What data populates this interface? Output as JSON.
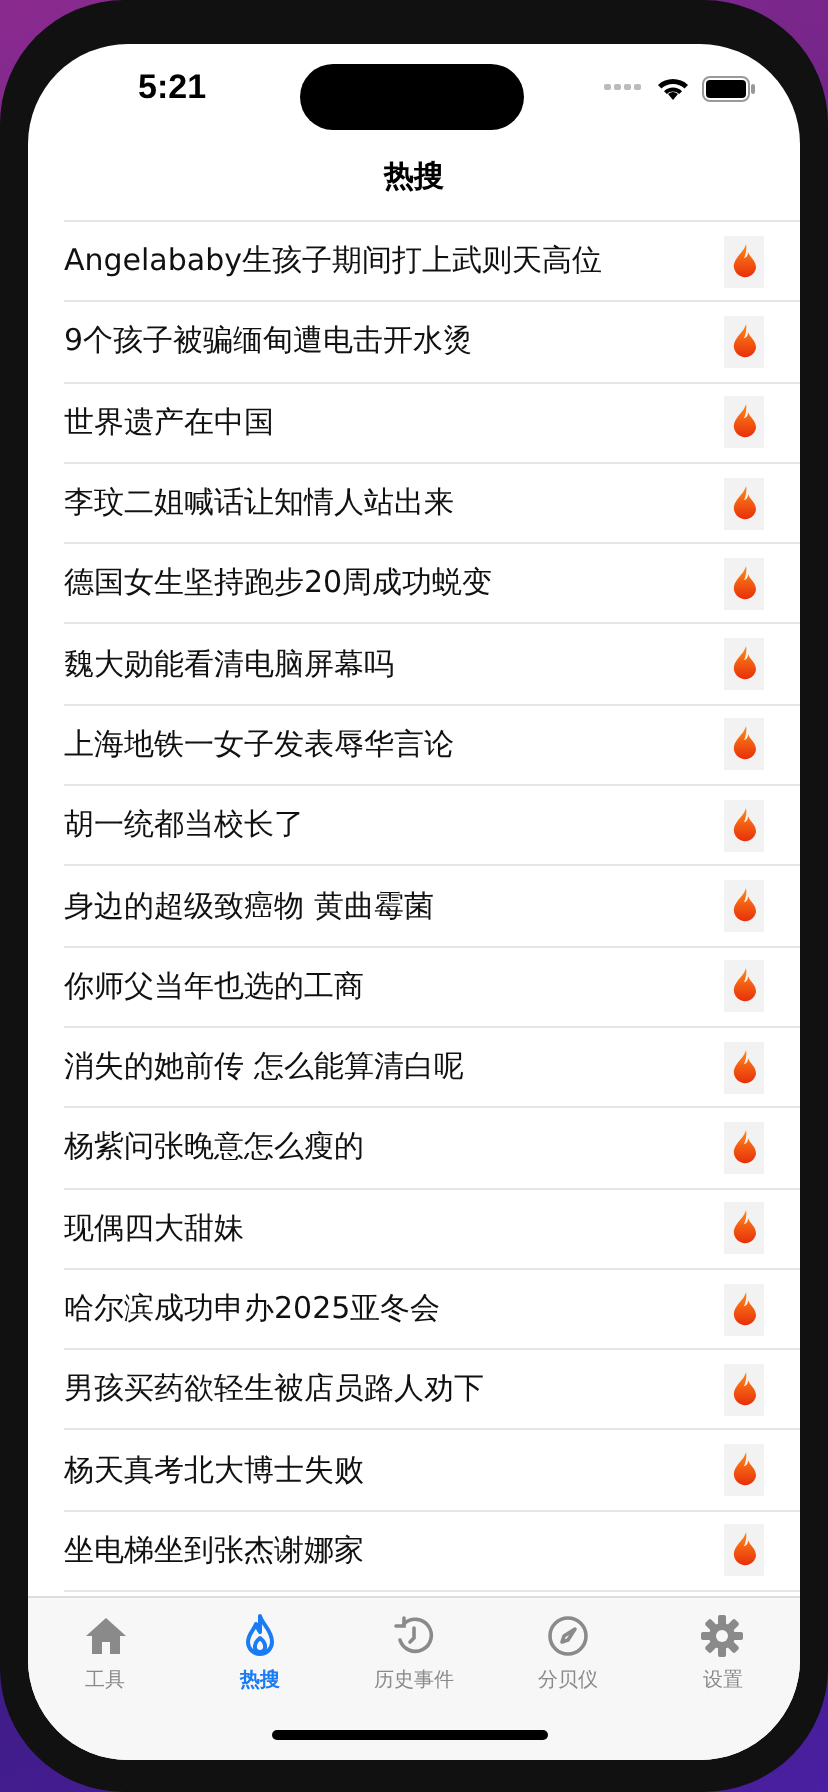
{
  "status_bar": {
    "time": "5:21"
  },
  "nav": {
    "title": "热搜"
  },
  "items": [
    {
      "title": "Angelababy生孩子期间打上武则天高位"
    },
    {
      "title": "9个孩子被骗缅甸遭电击开水烫"
    },
    {
      "title": "世界遗产在中国"
    },
    {
      "title": "李玟二姐喊话让知情人站出来"
    },
    {
      "title": "德国女生坚持跑步20周成功蜕变"
    },
    {
      "title": "魏大勋能看清电脑屏幕吗"
    },
    {
      "title": "上海地铁一女子发表辱华言论"
    },
    {
      "title": "胡一统都当校长了"
    },
    {
      "title": "身边的超级致癌物 黄曲霉菌"
    },
    {
      "title": "你师父当年也选的工商"
    },
    {
      "title": "消失的她前传 怎么能算清白呢"
    },
    {
      "title": "杨紫问张晚意怎么瘦的"
    },
    {
      "title": "现偶四大甜妹"
    },
    {
      "title": "哈尔滨成功申办2025亚冬会"
    },
    {
      "title": "男孩买药欲轻生被店员路人劝下"
    },
    {
      "title": "杨天真考北大博士失败"
    },
    {
      "title": "坐电梯坐到张杰谢娜家"
    }
  ],
  "tabs": [
    {
      "label": "工具",
      "kind": "home",
      "selected": false
    },
    {
      "label": "热搜",
      "kind": "flame",
      "selected": true
    },
    {
      "label": "历史事件",
      "kind": "history",
      "selected": false
    },
    {
      "label": "分贝仪",
      "kind": "gauge",
      "selected": false
    },
    {
      "label": "设置",
      "kind": "gear",
      "selected": false
    }
  ]
}
